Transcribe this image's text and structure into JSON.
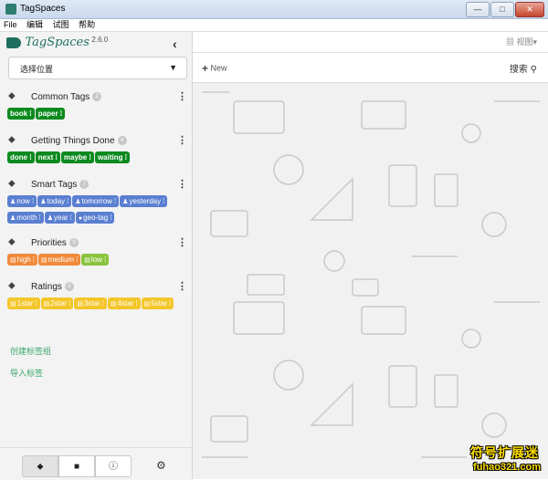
{
  "window": {
    "title": "TagSpaces",
    "controls": [
      "—",
      "□",
      "✕"
    ]
  },
  "menu": [
    "File",
    "编辑",
    "试图",
    "帮助"
  ],
  "logo": {
    "name": "TagSpaces",
    "version": "2.6.0"
  },
  "location": {
    "label": "选择位置"
  },
  "groups": [
    {
      "title": "Common Tags",
      "count": "2",
      "tags": [
        {
          "label": "book"
        },
        {
          "label": "paper"
        }
      ]
    },
    {
      "title": "Getting Things Done",
      "count": "4",
      "tags": [
        {
          "label": "done"
        },
        {
          "label": "next"
        },
        {
          "label": "maybe"
        },
        {
          "label": "waiting"
        }
      ]
    },
    {
      "title": "Smart Tags",
      "count": "7",
      "tags": [
        {
          "label": "now"
        },
        {
          "label": "today"
        },
        {
          "label": "tomorrow"
        },
        {
          "label": "yesterday"
        },
        {
          "label": "month"
        },
        {
          "label": "year"
        },
        {
          "label": "geo-tag"
        }
      ]
    },
    {
      "title": "Priorities",
      "count": "3",
      "tags": [
        {
          "label": "high"
        },
        {
          "label": "medium"
        },
        {
          "label": "low"
        }
      ]
    },
    {
      "title": "Ratings",
      "count": "5",
      "tags": [
        {
          "label": "1star"
        },
        {
          "label": "2star"
        },
        {
          "label": "3star"
        },
        {
          "label": "4star"
        },
        {
          "label": "5star"
        }
      ]
    }
  ],
  "links": {
    "create_group": "创建标签组",
    "import_tags": "导入标签"
  },
  "toolbar": {
    "view_label": "视图",
    "new_label": "New",
    "search_label": "搜索"
  },
  "colors": {
    "green": "#0b8a1e",
    "blue": "#5a7fd1",
    "orange": "#f08a3a",
    "light_green": "#8ac43e",
    "yellow": "#f3c62a",
    "brand": "#1d6e5e"
  },
  "watermark": {
    "line1": "符号扩展迷",
    "line2": "fuhao321.com"
  }
}
